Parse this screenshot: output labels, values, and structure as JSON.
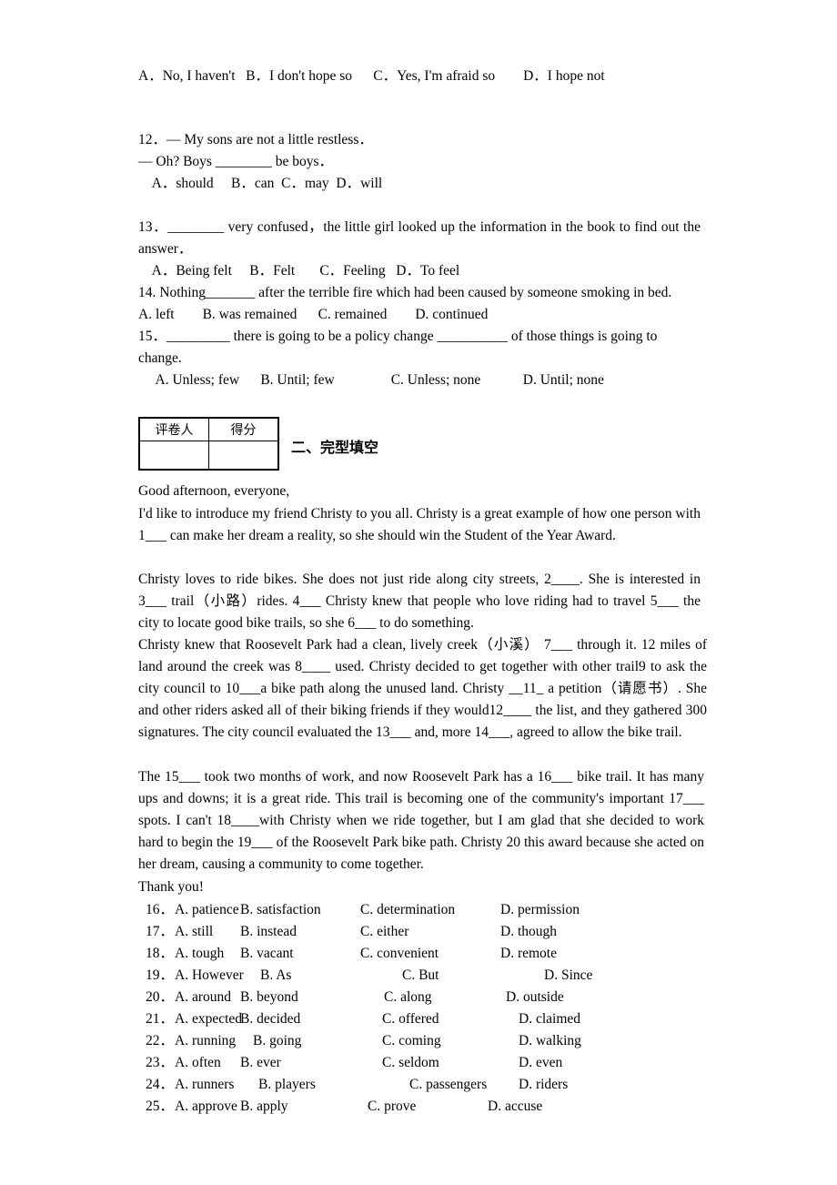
{
  "document": {
    "type": "english-exam-worksheet",
    "background": "#ffffff",
    "text_color": "#000000"
  },
  "q11_options": "A．No, I haven't   B．I don't hope so      C．Yes, I'm afraid so        D．I hope not",
  "q12": {
    "stem_line1": "12．— My sons are not a little restless．",
    "stem_line2": "— Oh? Boys ________ be boys．",
    "options": "    A．should     B．can  C．may  D．will"
  },
  "q13": {
    "stem": "13．________ very confused，the little girl looked up the information in the book to find out the answer．",
    "options": "    A．Being felt     B．Felt       C．Feeling   D．To feel"
  },
  "q14": {
    "stem": "14. Nothing_______ after the terrible fire which had been caused by someone smoking in bed.",
    "options": "A. left        B. was remained      C. remained        D. continued"
  },
  "q15": {
    "stem_line1": "15．_________ there is going to be a policy change __________ of those things is going to",
    "stem_line2": "change.",
    "options": "     A. Unless; few      B. Until; few                C. Unless; none            D. Until; none"
  },
  "score_table": {
    "header": [
      "评卷人",
      "得分"
    ],
    "body": [
      "",
      ""
    ]
  },
  "section_two": {
    "title": "二、完型填空"
  },
  "passage": {
    "salutation": "Good afternoon, everyone,",
    "p1": "I'd like to introduce my friend Christy to you all. Christy is a great example of how one person with 1___ can make her dream a reality, so she should win the Student of the Year Award.",
    "p2": "Christy loves to ride bikes. She does not just ride along city streets, 2____. She is interested in 3___ trail（小路）rides. 4___   Christy knew that people who love riding had to travel 5___ the city to locate good bike trails, so she 6___ to do something.",
    "p3": "Christy knew that Roosevelt Park had a clean, lively creek（小溪） 7___ through it. 12 miles of land around the creek was 8____ used. Christy decided to get together with other trail9 to ask the city council to 10___a bike path along the unused land. Christy  __11_ a petition（请愿书）. She and other riders asked all of their biking friends if they would12____ the list, and they gathered 300 signatures. The city council evaluated the 13___ and, more 14___, agreed to allow the bike trail.",
    "p4": "The 15___ took two months of work, and now Roosevelt Park has a 16___ bike trail. It has many ups and downs; it is a great ride. This trail is becoming one of the community's important 17___ spots. I can't 18____with Christy when we ride together, but I am glad that she decided to work hard to begin the 19___   of the Roosevelt Park bike path. Christy 20 this award because she acted on her dream, causing a community to come together.",
    "closing": "Thank you!"
  },
  "cloze_options": [
    {
      "num": "16．",
      "a": "A. patience",
      "b": "B. satisfaction",
      "c": "C. determination",
      "d": "D. permission"
    },
    {
      "num": "17．",
      "a": "A. still",
      "b": "B. instead",
      "c": "C. either",
      "d": "D. though"
    },
    {
      "num": "18．",
      "a": "A. tough",
      "b": "B. vacant",
      "c": "C. convenient",
      "d": "D. remote"
    },
    {
      "num": "19．",
      "a": "A. However",
      "b": "B. As",
      "c": "C. But",
      "d": "D. Since"
    },
    {
      "num": "20．",
      "a": "A. around",
      "b": "B. beyond",
      "c": "C. along",
      "d": "D. outside"
    },
    {
      "num": "21．",
      "a": "A. expected",
      "b": "B. decided",
      "c": "C. offered",
      "d": "D. claimed"
    },
    {
      "num": "22．",
      "a": "A. running",
      "b": "B. going",
      "c": "C. coming",
      "d": "D. walking"
    },
    {
      "num": "23．",
      "a": "A. often",
      "b": "B. ever",
      "c": "C. seldom",
      "d": "D. even"
    },
    {
      "num": "24．",
      "a": "A. runners",
      "b": "B. players",
      "c": "C. passengers",
      "d": "D. riders"
    },
    {
      "num": "25．",
      "a": "A. approve",
      "b": "B. apply",
      "c": "C. prove",
      "d": "D. accuse"
    }
  ],
  "cloze_option_layout": [
    {
      "b": 104,
      "c": 236,
      "d": 390
    },
    {
      "b": 104,
      "c": 236,
      "d": 390
    },
    {
      "b": 104,
      "c": 236,
      "d": 390
    },
    {
      "b": 126,
      "c": 282,
      "d": 438
    },
    {
      "b": 104,
      "c": 262,
      "d": 396
    },
    {
      "b": 104,
      "c": 260,
      "d": 410
    },
    {
      "b": 118,
      "c": 260,
      "d": 410
    },
    {
      "b": 104,
      "c": 260,
      "d": 410
    },
    {
      "b": 124,
      "c": 290,
      "d": 410
    },
    {
      "b": 104,
      "c": 244,
      "d": 376
    }
  ]
}
